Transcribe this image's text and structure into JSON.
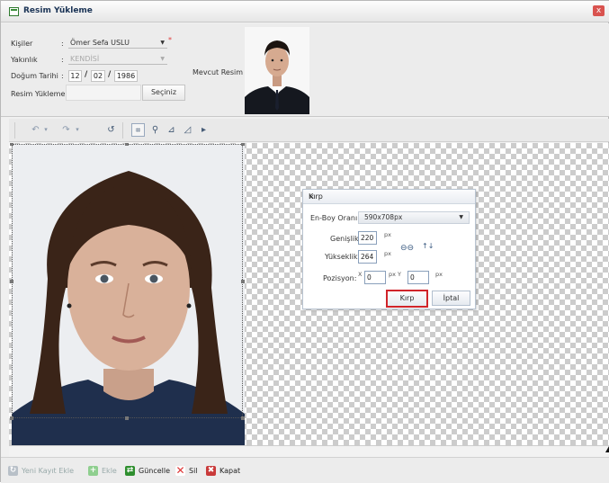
{
  "window": {
    "title": "Resim Yükleme",
    "close_glyph": "x"
  },
  "form": {
    "kisiler": {
      "label": "Kişiler",
      "value": "Ömer Sefa USLU",
      "required_mark": "*"
    },
    "yakinlik": {
      "label": "Yakınlık",
      "value": "KENDİSİ"
    },
    "dogum_tarihi": {
      "label": "Doğum Tarihi",
      "day": "12",
      "month": "02",
      "year": "1986",
      "separator": "/"
    },
    "resim_yukleme": {
      "label": "Resim Yükleme :",
      "button": "Seçiniz"
    },
    "mevcut_resim": {
      "label": "Mevcut Resim :"
    },
    "colon": ":"
  },
  "toolbar": {
    "icons": [
      "undo-icon",
      "undo-dropdown-icon",
      "redo-icon",
      "redo-dropdown-icon",
      "rotate-icon",
      "crop-icon",
      "zoom-icon",
      "flip-icon",
      "mirror-icon",
      "arrow-right-icon"
    ],
    "glyphs": [
      "↶",
      "▾",
      "↷",
      "▾",
      "↺",
      "⌗",
      "⚲",
      "⊿",
      "◿",
      "▸"
    ]
  },
  "crop_dialog": {
    "title": "Kırp",
    "close_glyph": "×",
    "ratio_label": "En-Boy Oranı:",
    "ratio_value": "590x708px",
    "width_label": "Genişlik:",
    "width_value": "220",
    "height_label": "Yükseklik:",
    "height_value": "264",
    "unit": "px",
    "position_label": "Pozisyon:",
    "x_label": "X",
    "x_value": "0",
    "y_label": "px Y",
    "y_value": "0",
    "crop_button": "Kırp",
    "cancel_button": "İptal",
    "link_glyph": "⊖⊖",
    "swap_glyph": "↑↓"
  },
  "bottom": {
    "new_record": "Yeni Kayıt Ekle",
    "add": "Ekle",
    "update": "Güncelle",
    "delete": "Sil",
    "close": "Kapat"
  },
  "colors": {
    "accent_red": "#d0242a",
    "add_green": "#3aa83a",
    "update_green": "#2f8f2f",
    "delete_red": "#d33",
    "close_red": "#c93a3a"
  }
}
